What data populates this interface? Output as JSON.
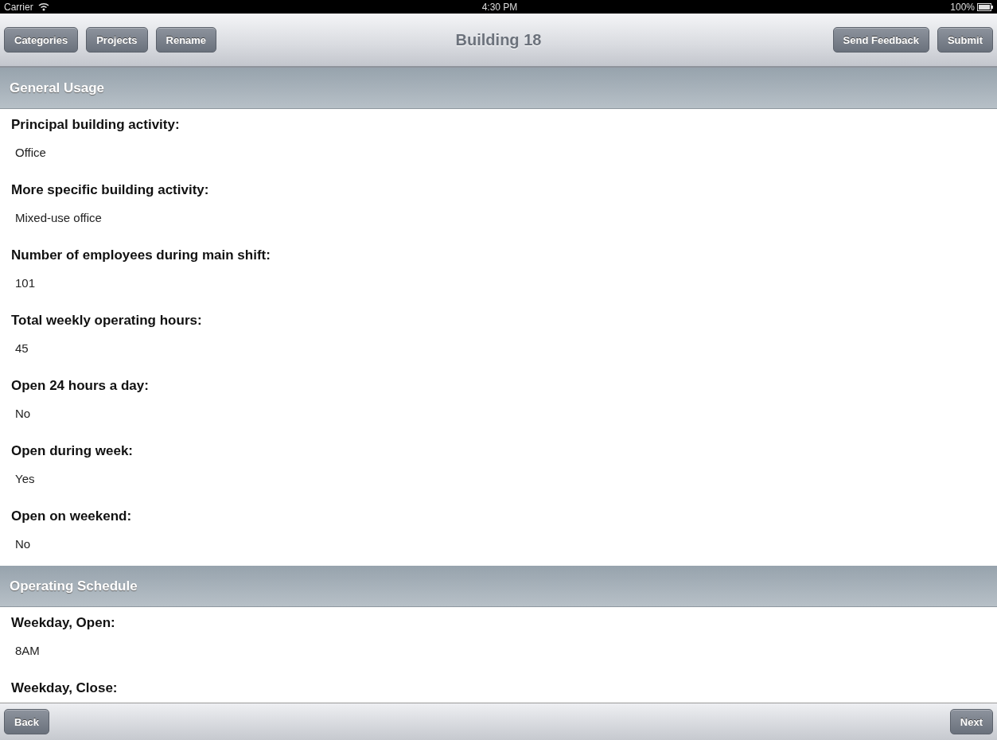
{
  "status_bar": {
    "carrier": "Carrier",
    "time": "4:30 PM",
    "battery": "100%"
  },
  "nav_bar": {
    "title": "Building 18",
    "left_buttons": [
      "Categories",
      "Projects",
      "Rename"
    ],
    "right_buttons": [
      "Send Feedback",
      "Submit"
    ]
  },
  "sections": [
    {
      "title": "General Usage",
      "fields": [
        {
          "label": "Principal building activity:",
          "value": "Office"
        },
        {
          "label": "More specific building activity:",
          "value": "Mixed-use office"
        },
        {
          "label": "Number of employees during main shift:",
          "value": "101"
        },
        {
          "label": "Total weekly operating hours:",
          "value": "45"
        },
        {
          "label": "Open 24 hours a day:",
          "value": "No"
        },
        {
          "label": "Open during week:",
          "value": "Yes"
        },
        {
          "label": "Open on weekend:",
          "value": "No"
        }
      ]
    },
    {
      "title": "Operating Schedule",
      "fields": [
        {
          "label": "Weekday, Open:",
          "value": "8AM"
        },
        {
          "label": "Weekday, Close:"
        }
      ]
    }
  ],
  "toolbar": {
    "back": "Back",
    "next": "Next"
  }
}
